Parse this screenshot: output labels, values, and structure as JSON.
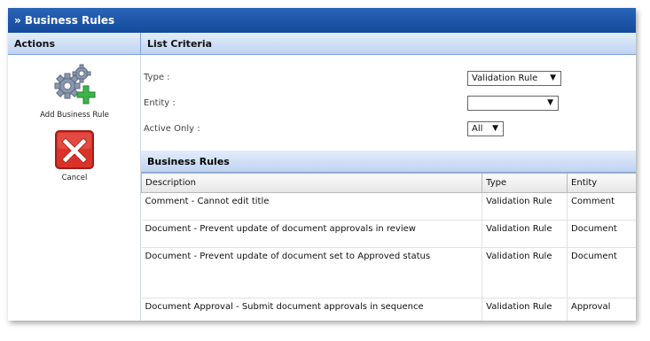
{
  "window": {
    "title": "» Business Rules"
  },
  "actions": {
    "header": "Actions",
    "items": [
      {
        "label": "Add Business Rule",
        "icon": "gear-add-icon"
      },
      {
        "label": "Cancel",
        "icon": "cancel-x-icon"
      }
    ]
  },
  "criteria": {
    "header": "List Criteria",
    "type": {
      "label": "Type :",
      "value": "Validation Rule"
    },
    "entity": {
      "label": "Entity :",
      "value": ""
    },
    "active_only": {
      "label": "Active Only :",
      "value": "All"
    }
  },
  "rules": {
    "header": "Business Rules",
    "columns": [
      "Description",
      "Type",
      "Entity"
    ],
    "rows": [
      {
        "description": "Comment - Cannot edit title",
        "type": "Validation Rule",
        "entity": "Comment"
      },
      {
        "description": "Document - Prevent update of document approvals in review",
        "type": "Validation Rule",
        "entity": "Document"
      },
      {
        "description": "Document - Prevent update of document set to Approved status",
        "type": "Validation Rule",
        "entity": "Document"
      },
      {
        "description": "Document Approval - Submit document approvals in sequence",
        "type": "Validation Rule",
        "entity": "Approval"
      }
    ]
  },
  "colors": {
    "titlebar": "#1c55a8",
    "section_header": "#cfdcf3",
    "cancel_red": "#d9322a",
    "add_green": "#3cb44a"
  }
}
